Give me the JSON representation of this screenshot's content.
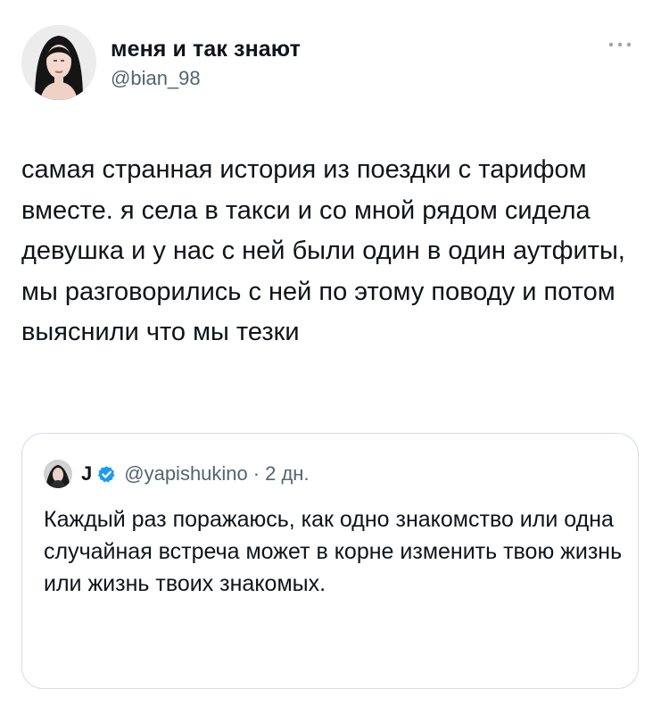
{
  "tweet": {
    "display_name": "меня и так знают",
    "handle": "@bian_98",
    "text": "самая странная история из поездки с тарифом вместе. я села в такси и со мной рядом сидела девушка и у нас с ней были один в один аутфиты, мы разговорились с ней по этому поводу и потом выяснили что мы тезки",
    "more_icon": "more-horizontal-icon",
    "avatar": "avatar-photo"
  },
  "quote": {
    "display_name": "J",
    "verified_icon": "verified-badge-icon",
    "verified_color": "#1d9bf0",
    "handle": "@yapishukino",
    "separator": "·",
    "time": "2 дн.",
    "text": "Каждый раз поражаюсь, как одно знакомство или одна случайная встреча может в корне изменить твою жизнь или жизнь твоих знакомых.",
    "avatar": "avatar-photo"
  },
  "colors": {
    "text_primary": "#0f1419",
    "text_secondary": "#536471",
    "card_border": "#d6dde3",
    "background": "#ffffff"
  }
}
